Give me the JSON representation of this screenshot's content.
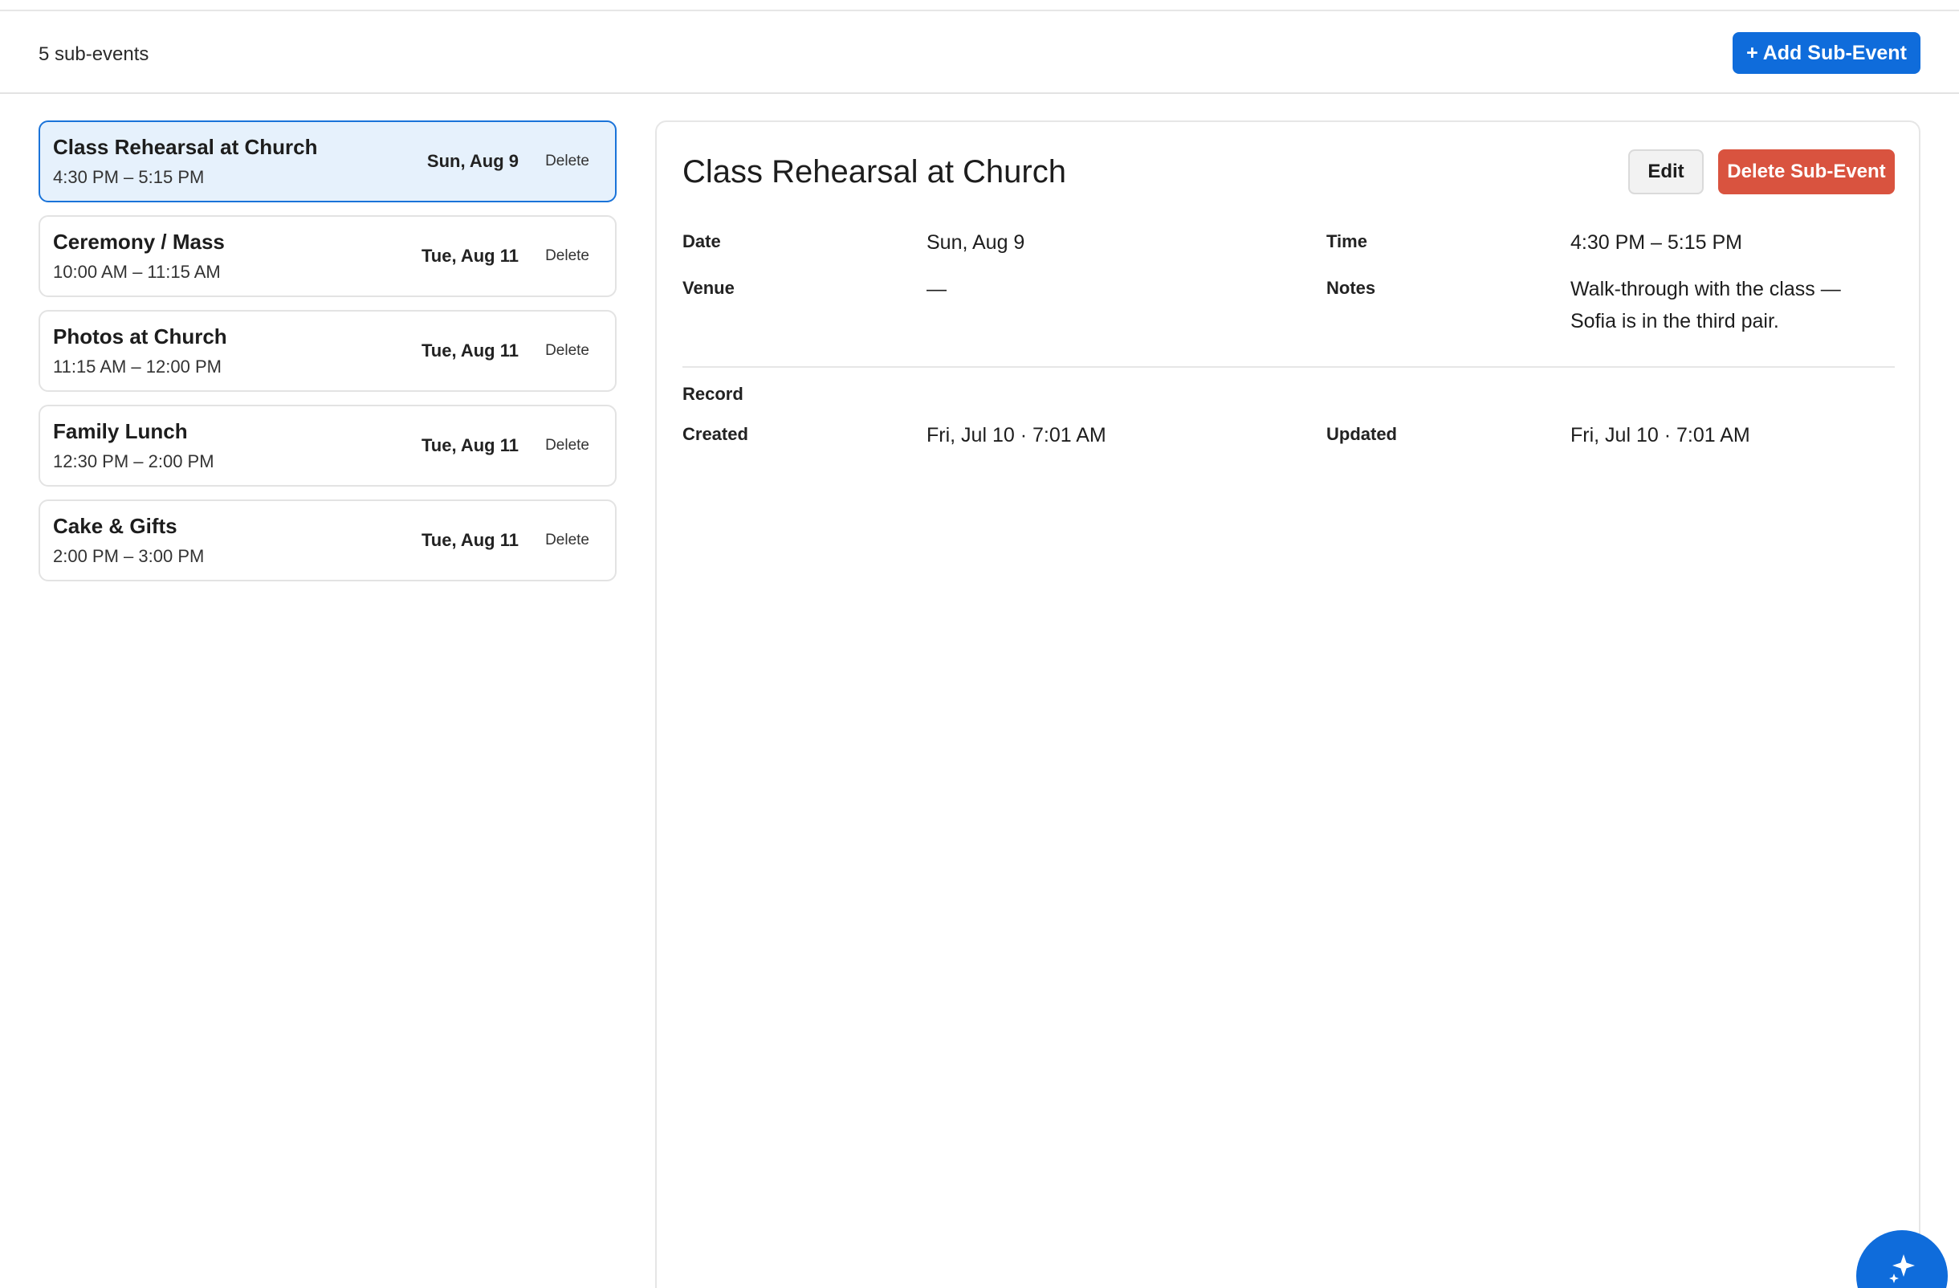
{
  "toolbar": {
    "count_label": "5 sub-events",
    "add_button_label": "+ Add Sub-Event"
  },
  "sub_events": [
    {
      "title": "Class Rehearsal at Church",
      "time": "4:30 PM – 5:15 PM",
      "date": "Sun, Aug 9",
      "delete_label": "Delete",
      "selected": true
    },
    {
      "title": "Ceremony / Mass",
      "time": "10:00 AM – 11:15 AM",
      "date": "Tue, Aug 11",
      "delete_label": "Delete",
      "selected": false
    },
    {
      "title": "Photos at Church",
      "time": "11:15 AM – 12:00 PM",
      "date": "Tue, Aug 11",
      "delete_label": "Delete",
      "selected": false
    },
    {
      "title": "Family Lunch",
      "time": "12:30 PM – 2:00 PM",
      "date": "Tue, Aug 11",
      "delete_label": "Delete",
      "selected": false
    },
    {
      "title": "Cake & Gifts",
      "time": "2:00 PM – 3:00 PM",
      "date": "Tue, Aug 11",
      "delete_label": "Delete",
      "selected": false
    }
  ],
  "detail": {
    "title": "Class Rehearsal at Church",
    "edit_label": "Edit",
    "delete_label": "Delete Sub-Event",
    "date_label": "Date",
    "date_value": "Sun, Aug 9",
    "time_label": "Time",
    "time_value": "4:30 PM – 5:15 PM",
    "venue_label": "Venue",
    "venue_value": "—",
    "notes_label": "Notes",
    "notes_value": "Walk-through with the class — Sofia is in the third pair.",
    "record_label": "Record",
    "created_label": "Created",
    "created_value": "Fri, Jul 10 · 7:01 AM",
    "updated_label": "Updated",
    "updated_value": "Fri, Jul 10 · 7:01 AM"
  },
  "fab": {
    "icon": "sparkle-icon"
  },
  "colors": {
    "primary": "#0f6cdb",
    "danger": "#d9533f",
    "selected_bg": "#e6f1fc",
    "selected_border": "#1a73d9"
  }
}
